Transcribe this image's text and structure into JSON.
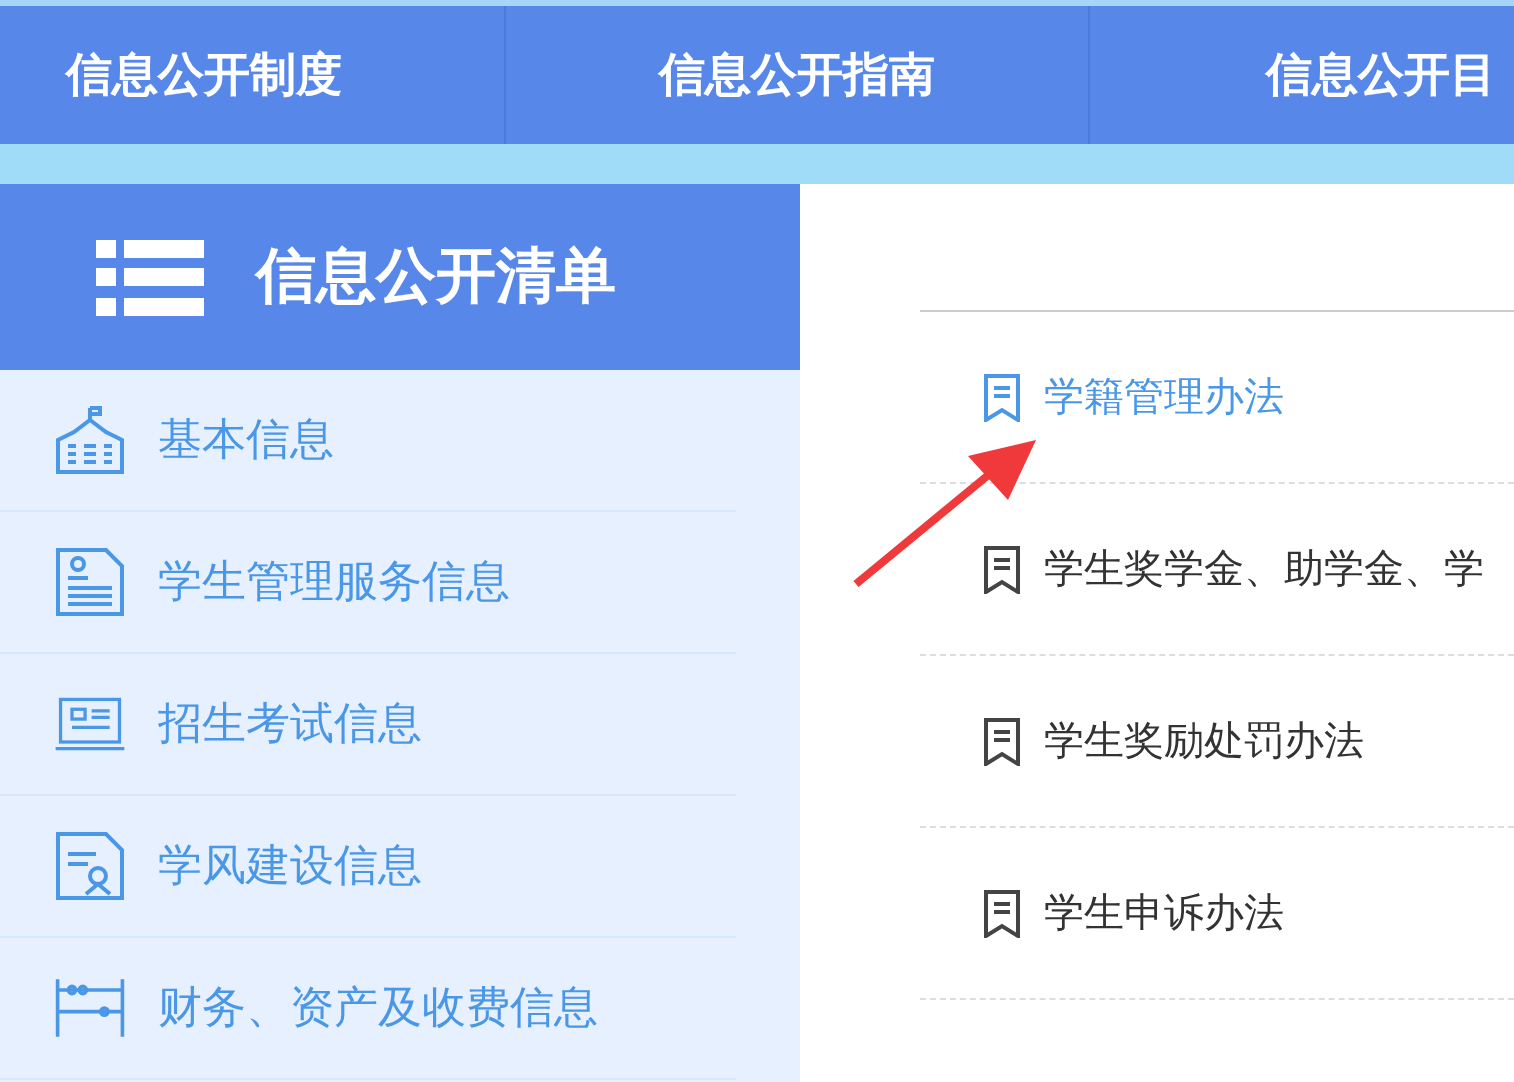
{
  "top_nav": [
    {
      "label": "信息公开制度"
    },
    {
      "label": "信息公开指南"
    },
    {
      "label": "信息公开目"
    }
  ],
  "sidebar": {
    "title": "信息公开清单",
    "items": [
      {
        "label": "基本信息"
      },
      {
        "label": "学生管理服务信息"
      },
      {
        "label": "招生考试信息"
      },
      {
        "label": "学风建设信息"
      },
      {
        "label": "财务、资产及收费信息"
      }
    ]
  },
  "documents": [
    {
      "title": "学籍管理办法",
      "selected": true
    },
    {
      "title": "学生奖学金、助学金、学",
      "selected": false
    },
    {
      "title": "学生奖励处罚办法",
      "selected": false
    },
    {
      "title": "学生申诉办法",
      "selected": false
    }
  ]
}
